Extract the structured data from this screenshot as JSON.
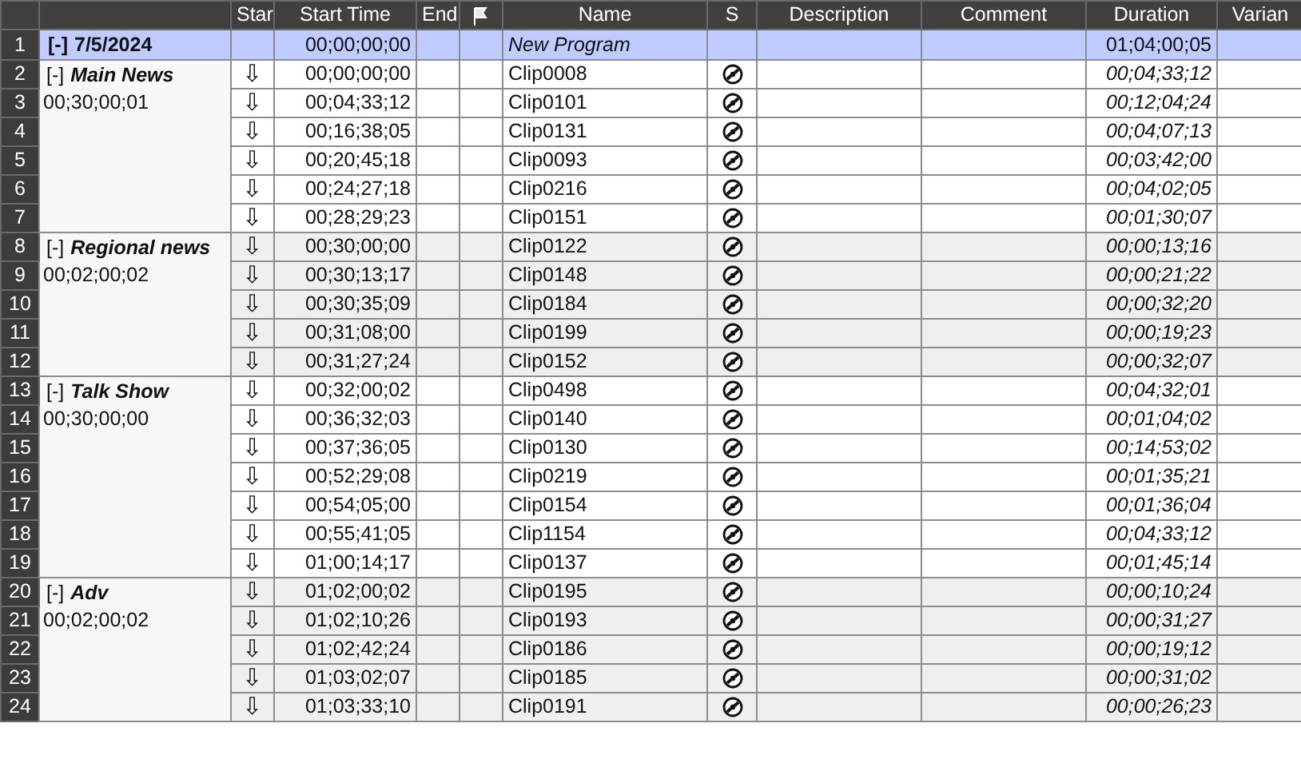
{
  "table": {
    "columns": [
      {
        "kind": "blank"
      },
      {
        "kind": "blank"
      },
      {
        "kind": "text",
        "label": "Star"
      },
      {
        "kind": "text",
        "label": "Start Time"
      },
      {
        "kind": "text",
        "label": "End"
      },
      {
        "kind": "flag"
      },
      {
        "kind": "text",
        "label": "Name"
      },
      {
        "kind": "text",
        "label": "S"
      },
      {
        "kind": "text",
        "label": "Description"
      },
      {
        "kind": "text",
        "label": "Comment"
      },
      {
        "kind": "text",
        "label": "Duration"
      },
      {
        "kind": "text",
        "label": "Varian"
      }
    ],
    "program": {
      "row_number": "1",
      "toggle": "[-]",
      "date": "7/5/2024",
      "start_time": "00;00;00;00",
      "name": "New Program",
      "duration": "01;04;00;05",
      "selected": true
    },
    "groups": [
      {
        "toggle": "[-]",
        "name": "Main News",
        "time": "00;30;00;01",
        "rows": [
          {
            "row_number": "2",
            "star": "⇩",
            "start_time": "00;00;00;00",
            "name": "Clip0008",
            "duration": "00;04;33;12"
          },
          {
            "row_number": "3",
            "star": "⇩",
            "start_time": "00;04;33;12",
            "name": "Clip0101",
            "duration": "00;12;04;24"
          },
          {
            "row_number": "4",
            "star": "⇩",
            "start_time": "00;16;38;05",
            "name": "Clip0131",
            "duration": "00;04;07;13"
          },
          {
            "row_number": "5",
            "star": "⇩",
            "start_time": "00;20;45;18",
            "name": "Clip0093",
            "duration": "00;03;42;00"
          },
          {
            "row_number": "6",
            "star": "⇩",
            "start_time": "00;24;27;18",
            "name": "Clip0216",
            "duration": "00;04;02;05"
          },
          {
            "row_number": "7",
            "star": "⇩",
            "start_time": "00;28;29;23",
            "name": "Clip0151",
            "duration": "00;01;30;07"
          }
        ]
      },
      {
        "toggle": "[-]",
        "name": "Regional news",
        "time": "00;02;00;02",
        "rows": [
          {
            "row_number": "8",
            "star": "⇩",
            "start_time": "00;30;00;00",
            "name": "Clip0122",
            "duration": "00;00;13;16"
          },
          {
            "row_number": "9",
            "star": "⇩",
            "start_time": "00;30;13;17",
            "name": "Clip0148",
            "duration": "00;00;21;22"
          },
          {
            "row_number": "10",
            "star": "⇩",
            "start_time": "00;30;35;09",
            "name": "Clip0184",
            "duration": "00;00;32;20"
          },
          {
            "row_number": "11",
            "star": "⇩",
            "start_time": "00;31;08;00",
            "name": "Clip0199",
            "duration": "00;00;19;23"
          },
          {
            "row_number": "12",
            "star": "⇩",
            "start_time": "00;31;27;24",
            "name": "Clip0152",
            "duration": "00;00;32;07"
          }
        ]
      },
      {
        "toggle": "[-]",
        "name": "Talk Show",
        "time": "00;30;00;00",
        "rows": [
          {
            "row_number": "13",
            "star": "⇩",
            "start_time": "00;32;00;02",
            "name": "Clip0498",
            "duration": "00;04;32;01"
          },
          {
            "row_number": "14",
            "star": "⇩",
            "start_time": "00;36;32;03",
            "name": "Clip0140",
            "duration": "00;01;04;02"
          },
          {
            "row_number": "15",
            "star": "⇩",
            "start_time": "00;37;36;05",
            "name": "Clip0130",
            "duration": "00;14;53;02"
          },
          {
            "row_number": "16",
            "star": "⇩",
            "start_time": "00;52;29;08",
            "name": "Clip0219",
            "duration": "00;01;35;21"
          },
          {
            "row_number": "17",
            "star": "⇩",
            "start_time": "00;54;05;00",
            "name": "Clip0154",
            "duration": "00;01;36;04"
          },
          {
            "row_number": "18",
            "star": "⇩",
            "start_time": "00;55;41;05",
            "name": "Clip1154",
            "duration": "00;04;33;12"
          },
          {
            "row_number": "19",
            "star": "⇩",
            "start_time": "01;00;14;17",
            "name": "Clip0137",
            "duration": "00;01;45;14"
          }
        ]
      },
      {
        "toggle": "[-]",
        "name": "Adv",
        "time": "00;02;00;02",
        "rows": [
          {
            "row_number": "20",
            "star": "⇩",
            "start_time": "01;02;00;02",
            "name": "Clip0195",
            "duration": "00;00;10;24"
          },
          {
            "row_number": "21",
            "star": "⇩",
            "start_time": "01;02;10;26",
            "name": "Clip0193",
            "duration": "00;00;31;27"
          },
          {
            "row_number": "22",
            "star": "⇩",
            "start_time": "01;02;42;24",
            "name": "Clip0186",
            "duration": "00;00;19;12"
          },
          {
            "row_number": "23",
            "star": "⇩",
            "start_time": "01;03;02;07",
            "name": "Clip0185",
            "duration": "00;00;31;02"
          },
          {
            "row_number": "24",
            "star": "⇩",
            "start_time": "01;03;33;10",
            "name": "Clip0191",
            "duration": "00;00;26;23"
          }
        ]
      }
    ]
  }
}
